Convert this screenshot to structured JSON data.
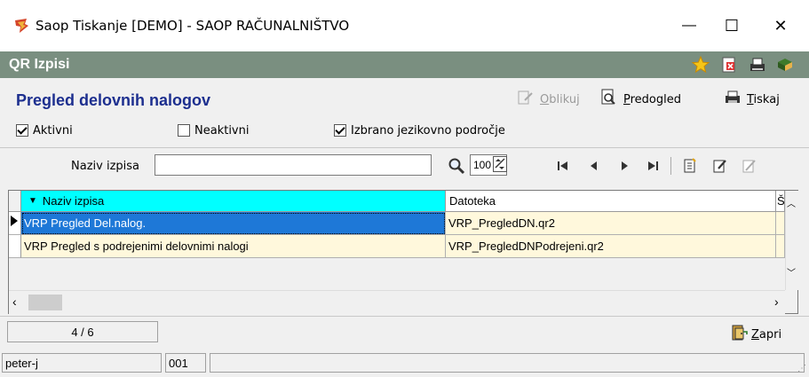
{
  "window": {
    "title": "Saop Tiskanje [DEMO] - SAOP RAČUNALNIŠTVO",
    "minimize_glyph": "—",
    "maximize_glyph": "☐",
    "close_glyph": "✕"
  },
  "header": {
    "module_title": "QR Izpisi",
    "icons": [
      "star-icon",
      "excel-export-icon",
      "printer-stack-icon",
      "book-icon"
    ]
  },
  "page": {
    "title": "Pregled delovnih nalogov",
    "toolbar": {
      "format_label_first": "O",
      "format_label_rest": "blikuj",
      "preview_label_first": "P",
      "preview_label_rest": "redogled",
      "print_label_first": "T",
      "print_label_rest": "iskaj"
    }
  },
  "filters": [
    {
      "label": "Aktivni",
      "checked": true
    },
    {
      "label": "Neaktivni",
      "checked": false
    },
    {
      "label": "Izbrano jezikovno področje",
      "checked": true
    }
  ],
  "search": {
    "label": "Naziv izpisa",
    "value": "",
    "zoom_value": "100"
  },
  "grid": {
    "columns": [
      "Naziv izpisa",
      "Datoteka",
      "Št"
    ],
    "rows": [
      {
        "name": "VRP Pregled Del.nalog.",
        "file": "VRP_PregledDN.qr2",
        "selected": true
      },
      {
        "name": "VRP Pregled s podrejenimi delovnimi nalogi",
        "file": "VRP_PregledDNPodrejeni.qr2",
        "selected": false
      }
    ]
  },
  "footer": {
    "record_counter": "4 / 6",
    "close_label_first": "Z",
    "close_label_rest": "apri"
  },
  "statusbar": {
    "user": "peter-j",
    "code": "001",
    "extra": ""
  },
  "colors": {
    "header_green": "#7a8f80",
    "title_blue": "#1d2f8f",
    "column_header_cyan": "#00ffff",
    "row_yellow": "#fff8dc",
    "selected_blue": "#1e78d7"
  }
}
